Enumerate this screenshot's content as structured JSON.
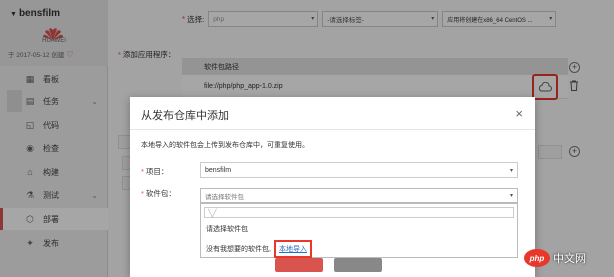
{
  "project": {
    "name": "bensfilm",
    "org": "HUAWEI",
    "created": "于 2017-05-12 创建"
  },
  "sidebar": {
    "items": [
      {
        "label": "看板",
        "icon": "dashboard-icon",
        "chevron": false
      },
      {
        "label": "任务",
        "icon": "task-icon",
        "chevron": true
      },
      {
        "label": "代码",
        "icon": "code-icon",
        "chevron": false
      },
      {
        "label": "检查",
        "icon": "check-icon",
        "chevron": false
      },
      {
        "label": "构建",
        "icon": "build-icon",
        "chevron": false
      },
      {
        "label": "测试",
        "icon": "test-icon",
        "chevron": true
      },
      {
        "label": "部署",
        "icon": "deploy-icon",
        "chevron": false,
        "active": true
      },
      {
        "label": "发布",
        "icon": "release-icon",
        "chevron": false
      }
    ]
  },
  "form": {
    "select_label": "选择:",
    "select_value": "php",
    "tag_placeholder": "-请选择标签-",
    "env_value": "应用将创建在x86_64 CentOS ...",
    "add_apps_label": "添加应用程序：",
    "table_header": "软件包路径",
    "package_path": "file://php/php_app-1.0.zip"
  },
  "modal": {
    "title": "从发布仓库中添加",
    "close": "×",
    "description": "本地导入的软件包会上传到发布仓库中，可重复使用。",
    "project_label": "项目：",
    "project_value": "bensfilm",
    "package_label": "软件包：",
    "package_placeholder": "请选择软件包",
    "dropdown_option": "请选择软件包",
    "no_package_text": "没有我想要的软件包,",
    "import_link": "本地导入"
  },
  "watermark": {
    "logo": "php",
    "text": "中文网"
  },
  "colors": {
    "accent_red": "#e8372b",
    "link_blue": "#2b6cc4"
  }
}
